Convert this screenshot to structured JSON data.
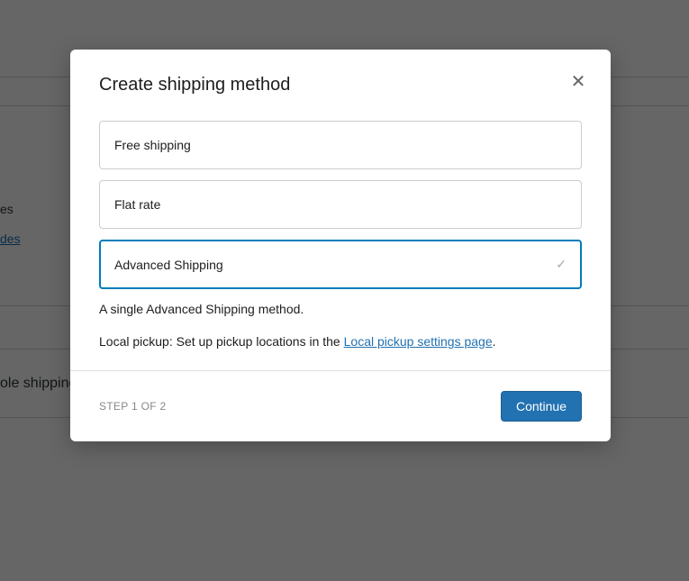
{
  "background": {
    "text_es": "es",
    "link_des": "des",
    "text_shipping": "ole shipping"
  },
  "modal": {
    "title": "Create shipping method",
    "options": [
      {
        "label": "Free shipping",
        "selected": false
      },
      {
        "label": "Flat rate",
        "selected": false
      },
      {
        "label": "Advanced Shipping",
        "selected": true
      }
    ],
    "description": "A single Advanced Shipping method.",
    "local_pickup_prefix": "Local pickup: Set up pickup locations in the ",
    "local_pickup_link": "Local pickup settings page",
    "local_pickup_suffix": ".",
    "step_label": "STEP 1 OF 2",
    "continue_label": "Continue"
  }
}
